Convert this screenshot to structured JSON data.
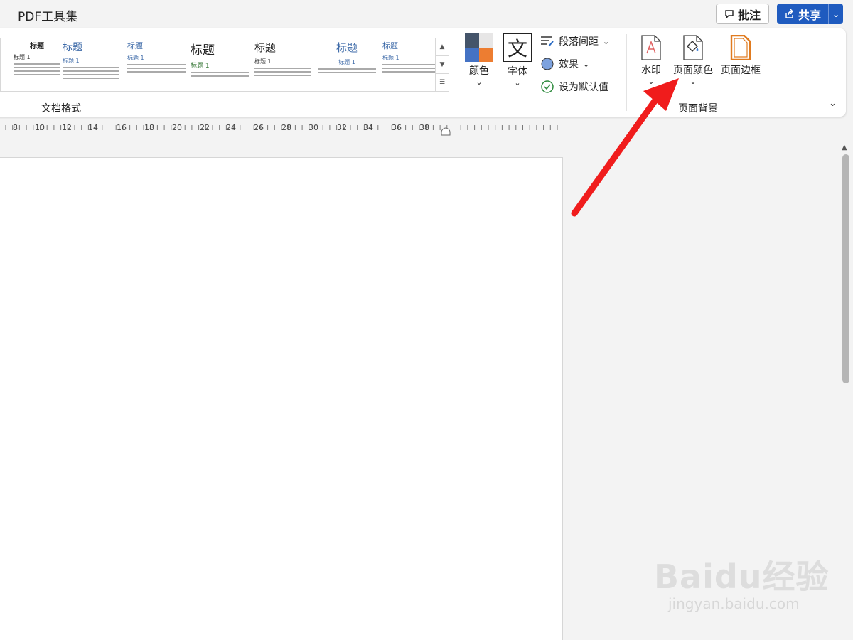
{
  "app": {
    "tab_fragment": "",
    "tab_pdf": "PDF工具集"
  },
  "header_actions": {
    "comment_label": "批注",
    "share_label": "共享",
    "share_color": "#1f5bbf"
  },
  "ribbon": {
    "styles_gallery": {
      "group_label": "文档格式",
      "items": [
        {
          "title": "标题",
          "heading": "标题 1"
        },
        {
          "title": "标题",
          "heading": "标题 1"
        },
        {
          "title": "标题",
          "heading": "标题 1"
        },
        {
          "title": "标题",
          "heading": "标题 1"
        },
        {
          "title": "标题",
          "heading": "标题 1"
        },
        {
          "title": "标题",
          "heading": "标题 1"
        },
        {
          "title": "标题",
          "heading": "标题 1"
        }
      ]
    },
    "design": {
      "colors_label": "颜色",
      "fonts_label": "字体",
      "paragraph_spacing_label": "段落间距",
      "effects_label": "效果",
      "set_default_label": "设为默认值"
    },
    "page_background": {
      "group_label": "页面背景",
      "watermark_label": "水印",
      "page_color_label": "页面颜色",
      "page_borders_label": "页面边框"
    }
  },
  "ruler": {
    "labels": [
      "8",
      "10",
      "12",
      "14",
      "16",
      "18",
      "20",
      "22",
      "24",
      "26",
      "28",
      "30",
      "32",
      "34",
      "36",
      "38"
    ]
  },
  "watermark": {
    "brand": "Baidu经验",
    "site": "jingyan.baidu.com"
  }
}
